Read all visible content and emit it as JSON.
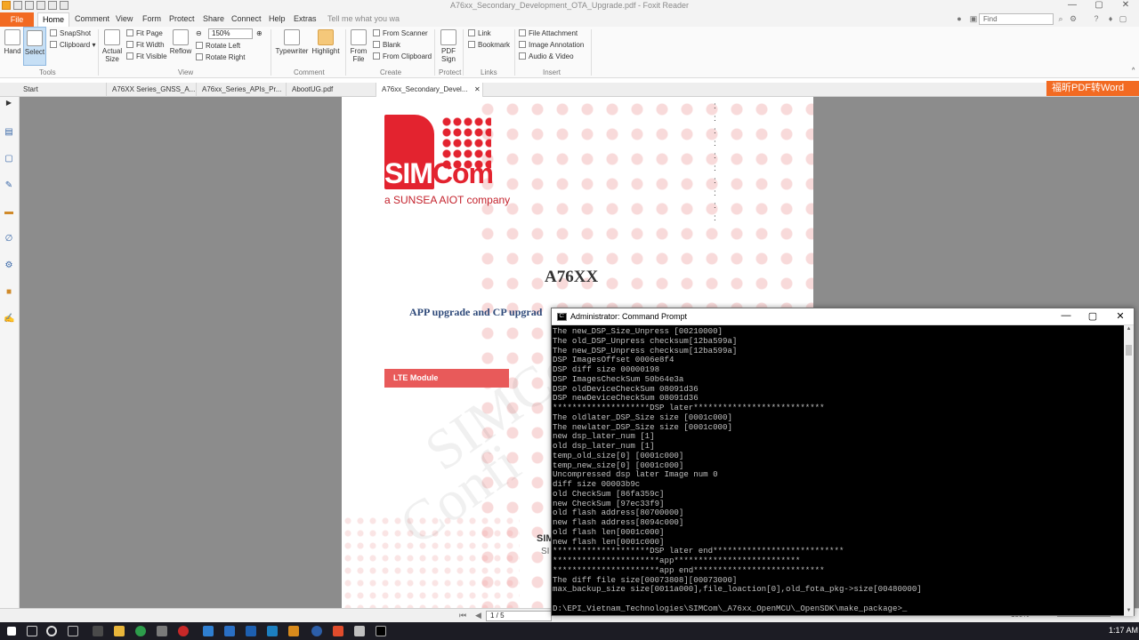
{
  "window": {
    "title": "A76xx_Secondary_Development_OTA_Upgrade.pdf - Foxit Reader",
    "controls": {
      "minimize": "—",
      "restore": "▢",
      "close": "✕"
    }
  },
  "menu": {
    "file": "File",
    "items": [
      "Home",
      "Comment",
      "View",
      "Form",
      "Protect",
      "Share",
      "Connect",
      "Help",
      "Extras"
    ],
    "active": "Home",
    "tell_me": "Tell me what you wa",
    "find_placeholder": "Find"
  },
  "ribbon": {
    "tools": {
      "hand": "Hand",
      "select": "Select",
      "snapshot": "SnapShot",
      "clipboard": "Clipboard",
      "group": "Tools"
    },
    "view": {
      "actual_size": "Actual Size",
      "fit_page": "Fit Page",
      "fit_width": "Fit Width",
      "fit_visible": "Fit Visible",
      "reflow": "Reflow",
      "zoom": "150%",
      "rotate_left": "Rotate Left",
      "rotate_right": "Rotate Right",
      "group": "View"
    },
    "comment": {
      "typewriter": "Typewriter",
      "highlight": "Highlight",
      "group": "Comment"
    },
    "create": {
      "from_file": "From File",
      "from_scanner": "From Scanner",
      "blank": "Blank",
      "from_clipboard": "From Clipboard",
      "group": "Create"
    },
    "protect": {
      "pdf_sign": "PDF Sign",
      "group": "Protect"
    },
    "links": {
      "link": "Link",
      "bookmark": "Bookmark",
      "group": "Links"
    },
    "insert": {
      "file_attachment": "File Attachment",
      "image_annotation": "Image Annotation",
      "audio_video": "Audio & Video",
      "group": "Insert"
    }
  },
  "tabs": [
    "Start",
    "A76XX Series_GNSS_A...",
    "A76xx_Series_APIs_Pr...",
    "AbootUG.pdf",
    "A76xx_Secondary_Devel..."
  ],
  "active_tab": 4,
  "ad_banner": "福昕PDF转Word",
  "page": {
    "logo_sim": "SIM",
    "logo_com": "Com",
    "logo_sub": "a SUNSEA AIOT company",
    "title": "A76XX",
    "subtitle": "APP upgrade and CP upgrad",
    "module_box": "LTE Module",
    "footer_brand": "SIM",
    "footer_sub": "SI",
    "watermark_1": "SIMCom",
    "watermark_2": "Confi"
  },
  "statusbar": {
    "page_indicator": "1 / 5",
    "zoom": "150%"
  },
  "cmd": {
    "title": "Administrator: Command Prompt",
    "lines": [
      "The new_DSP_Size_Unpress [00210000]",
      "The old_DSP_Unpress checksum[12ba599a]",
      "The new_DSP_Unpress checksum[12ba599a]",
      "DSP ImagesOffset 0006e8f4",
      "DSP diff size 00000198",
      "DSP ImagesCheckSum 50b64e3a",
      "DSP oldDeviceCheckSum 08091d36",
      "DSP newDeviceCheckSum 08091d36",
      "********************DSP later***************************",
      "The oldlater_DSP_Size size [0001c000]",
      "The newlater_DSP_Size size [0001c000]",
      "new dsp_later_num [1]",
      "old dsp_later_num [1]",
      "temp_old_size[0] [0001c000]",
      "temp_new_size[0] [0001c000]",
      "Uncompressed dsp later Image num 0",
      "diff size 00003b9c",
      "old CheckSum [86fa359c]",
      "new CheckSum [97ec33f9]",
      "old flash address[80700000]",
      "new flash address[8094c000]",
      "old flash len[0001c000]",
      "new flash len[0001c000]",
      "********************DSP later end***************************",
      "**********************app**************************",
      "**********************app end***************************",
      "The diff file size[00073808][00073000]",
      "max_backup_size size[0011a000],file_loaction[0],old_fota_pkg->size[00480000]",
      "",
      "D:\\EPI_Vietnam_Technologies\\SIMCom\\_A76xx_OpenMCU\\_OpenSDK\\make_package>_"
    ]
  },
  "taskbar": {
    "time": "1:17 AM"
  }
}
